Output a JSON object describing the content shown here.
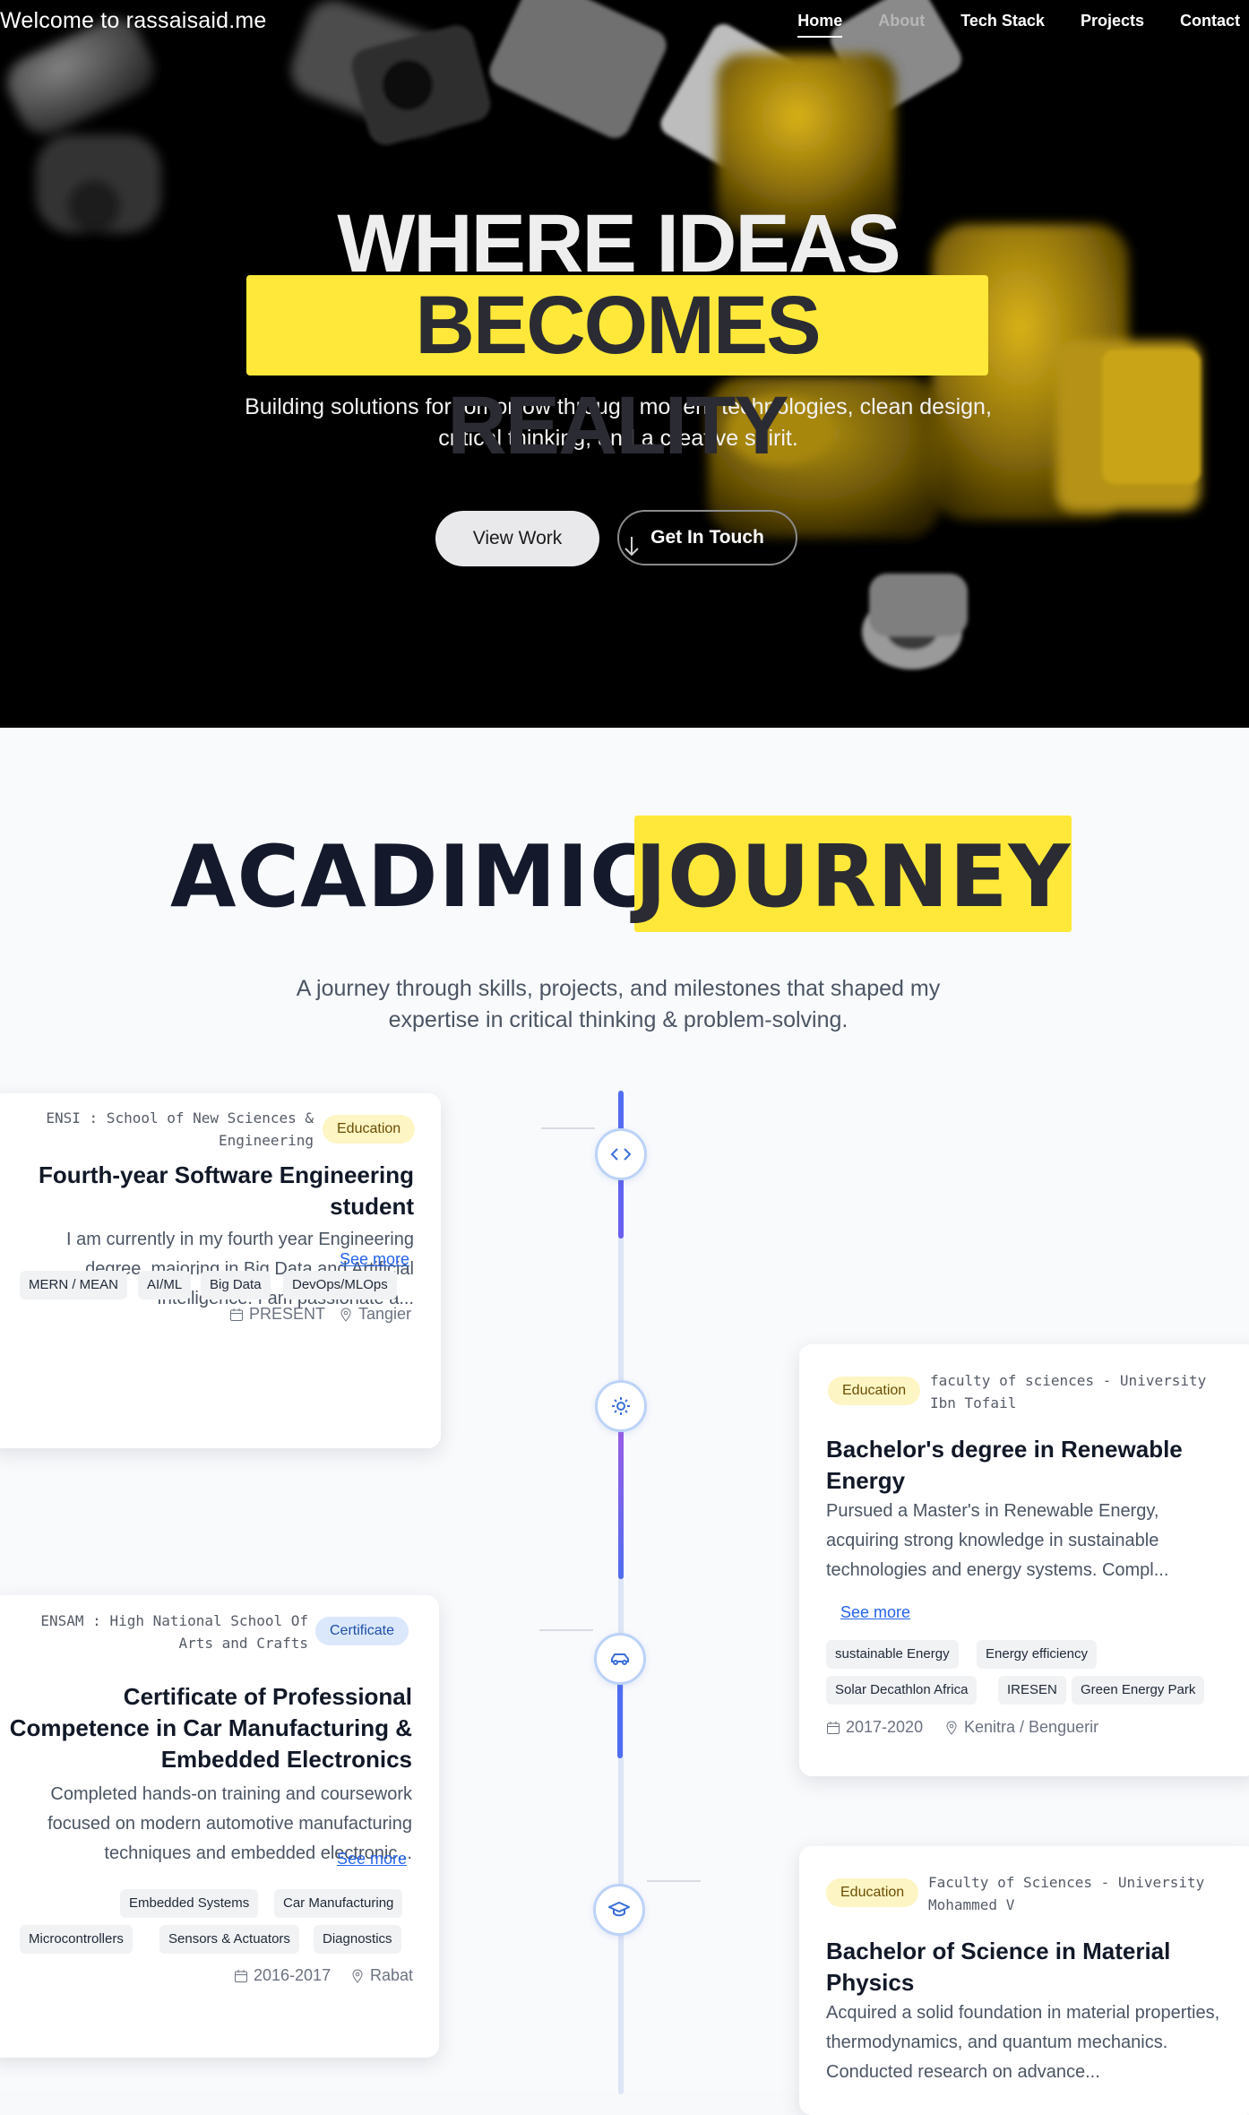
{
  "nav": {
    "brand": "Welcome to rassaisaid.me",
    "links": [
      "Home",
      "About",
      "Tech Stack",
      "Projects",
      "Contact"
    ]
  },
  "hero": {
    "title_line1": "WHERE IDEAS",
    "title_line2": "BECOMES REALITY",
    "subtitle": "Building solutions for tomorrow through modern technologies, clean design, critical thinking, and a creative spirit.",
    "btn_view": "View Work",
    "btn_touch": "Get In Touch"
  },
  "journey": {
    "title_a": "ACADIMIC",
    "title_b": "JOURNEY",
    "subtitle": "A journey through skills, projects, and milestones that shaped my expertise in critical thinking & problem-solving.",
    "cards": [
      {
        "institution": "ENSI : School of New Sciences & Engineering",
        "badge": "Education",
        "title": "Fourth-year Software Engineering student",
        "description": "I am currently in my fourth year Engineering degree, majoring in Big Data and Artificial Intelligence. I am passionate a...",
        "see_more": "See more",
        "tags": [
          "MERN / MEAN",
          "AI/ML",
          "Big Data",
          "DevOps/MLOps"
        ],
        "date": "PRESENT",
        "location": "Tangier"
      },
      {
        "institution": "faculty of sciences - University Ibn Tofail",
        "badge": "Education",
        "title": "Bachelor's degree in Renewable Energy",
        "description": "Pursued a Master's in Renewable Energy, acquiring strong knowledge in sustainable technologies and energy systems. Compl...",
        "see_more": "See more",
        "tags": [
          "sustainable Energy",
          "Energy efficiency",
          "Solar Decathlon Africa",
          "IRESEN",
          "Green Energy Park"
        ],
        "date": "2017-2020",
        "location": "Kenitra / Benguerir"
      },
      {
        "institution": "ENSAM : High National School Of Arts and Crafts",
        "badge": "Certificate",
        "title": "Certificate of Professional Competence in Car Manufacturing & Embedded Electronics",
        "description": "Completed hands-on training and coursework focused on modern automotive manufacturing techniques and embedded electronic...",
        "see_more": "See more",
        "tags": [
          "Embedded Systems",
          "Car Manufacturing",
          "Microcontrollers",
          "Sensors & Actuators",
          "Diagnostics"
        ],
        "date": "2016-2017",
        "location": "Rabat"
      },
      {
        "institution": "Faculty of Sciences - University Mohammed V",
        "badge": "Education",
        "title": "Bachelor of Science in Material Physics",
        "description": "Acquired a solid foundation in material properties, thermodynamics, and quantum mechanics. Conducted research on advance..."
      }
    ]
  },
  "colors": {
    "accent_yellow": "#ffe83a",
    "link_blue": "#2563eb",
    "timeline_blue": "#4f6df0",
    "timeline_purple": "#9b5de5"
  },
  "icons": [
    "code-icon",
    "sun-icon",
    "car-icon",
    "graduation-cap-icon",
    "calendar-icon",
    "map-pin-icon",
    "arrow-down-icon"
  ]
}
